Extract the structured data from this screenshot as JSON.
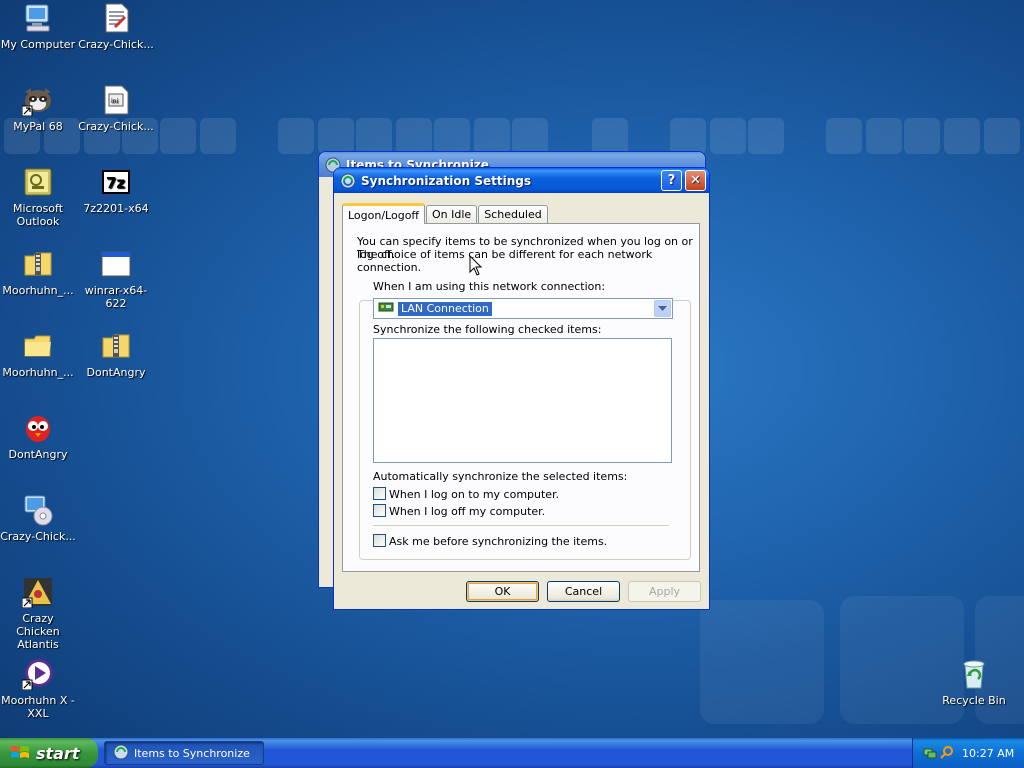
{
  "desktop": {
    "icons": [
      {
        "label": "My Computer",
        "icon": "my-computer-icon"
      },
      {
        "label": "Crazy-Chick...",
        "icon": "document-icon"
      },
      {
        "label": "MyPal 68",
        "icon": "raccoon-icon"
      },
      {
        "label": "Crazy-Chick...",
        "icon": "config-file-icon"
      },
      {
        "label": "Microsoft Outlook",
        "icon": "outlook-icon"
      },
      {
        "label": "7z2201-x64",
        "icon": "7zip-icon"
      },
      {
        "label": "Moorhuhn_...",
        "icon": "zip-folder-icon"
      },
      {
        "label": "winrar-x64-622",
        "icon": "application-window-icon"
      },
      {
        "label": "Moorhuhn_...",
        "icon": "folder-icon"
      },
      {
        "label": "DontAngry",
        "icon": "zip-folder-icon"
      },
      {
        "label": "DontAngry",
        "icon": "red-bird-icon"
      },
      {
        "label": "Crazy-Chick...",
        "icon": "cd-install-icon"
      },
      {
        "label": "Crazy Chicken Atlantis",
        "icon": "chicken-game-icon"
      },
      {
        "label": "Moorhuhn X - XXL",
        "icon": "play-shortcut-icon"
      },
      {
        "label": "Recycle Bin",
        "icon": "recycle-bin-icon"
      }
    ]
  },
  "back_window": {
    "title": "Items to Synchronize"
  },
  "dialog": {
    "title": "Synchronization Settings",
    "help_label": "?",
    "close_label": "✕",
    "tabs": [
      "Logon/Logoff",
      "On Idle",
      "Scheduled"
    ],
    "intro_line1": "You can specify items to be synchronized when you log on or log off.",
    "intro_line2": "The choice of items can be different for each network connection.",
    "connection_label": "When I am using this network connection:",
    "connection_value": "LAN Connection",
    "items_label": "Synchronize the following checked items:",
    "auto_label": "Automatically synchronize the selected items:",
    "check_logon": "When I log on to my computer.",
    "check_logoff": "When I log off my computer.",
    "check_ask": "Ask me before synchronizing the items.",
    "ok_label": "OK",
    "cancel_label": "Cancel",
    "apply_label": "Apply"
  },
  "taskbar": {
    "start_label": "start",
    "task_label": "Items to Synchronize",
    "clock": "10:27 AM"
  },
  "colors": {
    "xp_blue_title": "#0758d8",
    "start_green": "#37963c",
    "selection": "#316ac5"
  }
}
